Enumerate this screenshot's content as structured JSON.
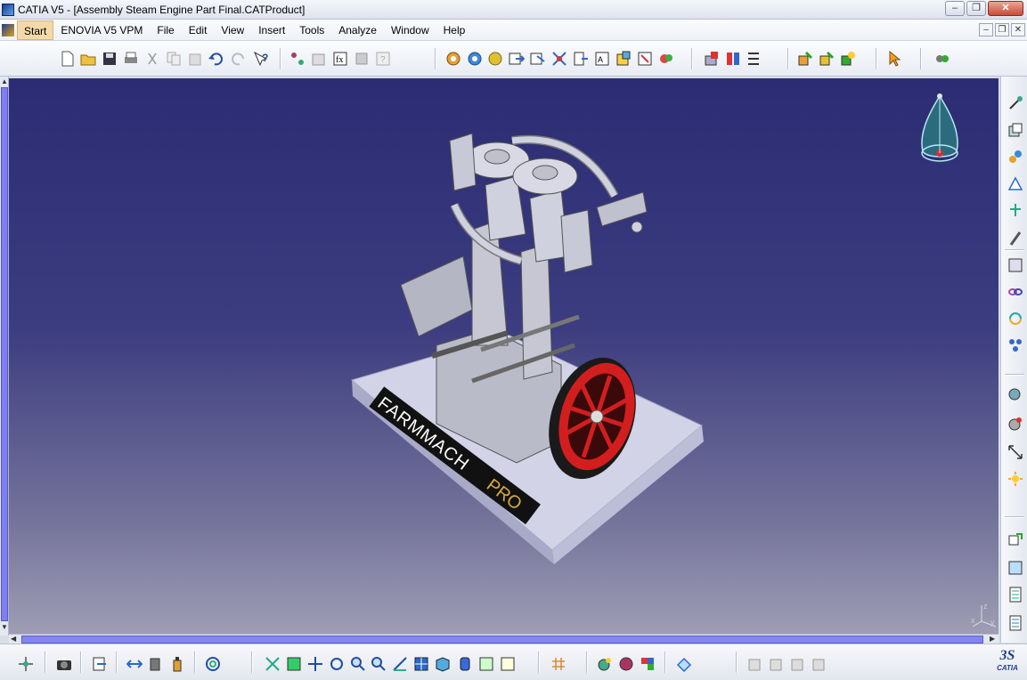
{
  "window": {
    "title": "CATIA V5 - [Assembly Steam Engine Part Final.CATProduct]",
    "controls": {
      "minimize": "–",
      "maximize": "❐",
      "close": "✕"
    }
  },
  "menubar": {
    "items": [
      {
        "label": "Start",
        "active": true
      },
      {
        "label": "ENOVIA V5 VPM"
      },
      {
        "label": "File"
      },
      {
        "label": "Edit"
      },
      {
        "label": "View"
      },
      {
        "label": "Insert"
      },
      {
        "label": "Tools"
      },
      {
        "label": "Analyze"
      },
      {
        "label": "Window"
      },
      {
        "label": "Help"
      }
    ],
    "mdi_controls": {
      "minimize": "–",
      "restore": "❐",
      "close": "✕"
    }
  },
  "toolbar_top": {
    "icons": [
      "new-icon",
      "open-icon",
      "save-icon",
      "print-icon",
      "cut-icon",
      "copy-icon",
      "paste-icon",
      "undo-icon",
      "redo-icon",
      "whats-this-icon",
      "product-icon",
      "part-icon",
      "existing-component-icon",
      "replace-component-icon",
      "graph-tree-icon",
      "manipulate-icon",
      "snap-icon",
      "explode-icon",
      "stop-manipulate-icon",
      "clash-icon",
      "constraint-icon",
      "fix-icon",
      "contact-icon",
      "offset-icon",
      "angle-icon",
      "reuse-pattern-icon",
      "multi-constraint-icon",
      "update-icon",
      "catalog-icon",
      "sectioning-icon",
      "distance-icon",
      "measure-icon",
      "select-icon",
      "tools-icon"
    ]
  },
  "toolbar_right": {
    "icons": [
      "sketch-icon",
      "pad-icon",
      "insert-component-icon",
      "move-icon",
      "snap-right-icon",
      "clip-icon",
      "product-structure-icon",
      "link-icon",
      "rotate-icon",
      "multi-instance-icon",
      "scene-icon",
      "analysis-icon",
      "measure-between-icon",
      "light-icon",
      "view-icon",
      "fix-together-icon",
      "bill-icon",
      "report-icon"
    ]
  },
  "toolbar_bottom": {
    "icons": [
      "compass-reset-icon",
      "capture-icon",
      "swap-icon",
      "normal-view-icon",
      "measure-item-icon",
      "bottle-icon",
      "spin-icon",
      "fly-icon",
      "fit-all-icon",
      "pan-icon",
      "rotate-view-icon",
      "zoom-in-icon",
      "zoom-out-icon",
      "normal-to-icon",
      "quick-view-icon",
      "iso-view-icon",
      "shading-icon",
      "hide-show-icon",
      "swap-visible-space-icon",
      "grid-icon",
      "apply-material-icon",
      "render-icon",
      "color-icon",
      "mirror-icon",
      "layer-icon-1",
      "layer-icon-2",
      "layer-icon-3",
      "layer-icon-4"
    ],
    "brand": {
      "mark": "3S",
      "text": "CATIA"
    }
  },
  "viewport": {
    "model": "steam-engine-assembly",
    "base_label_1": "FARMMACH",
    "base_label_2": "PRO",
    "axis": {
      "x": "x",
      "y": "y",
      "z": "z"
    },
    "colors": {
      "bg_top": "#2c2c74",
      "bg_bottom": "#9e9db4",
      "flywheel": "#d21e1e",
      "base": "#cfd0e3",
      "label_accent": "#d8a93a"
    }
  }
}
